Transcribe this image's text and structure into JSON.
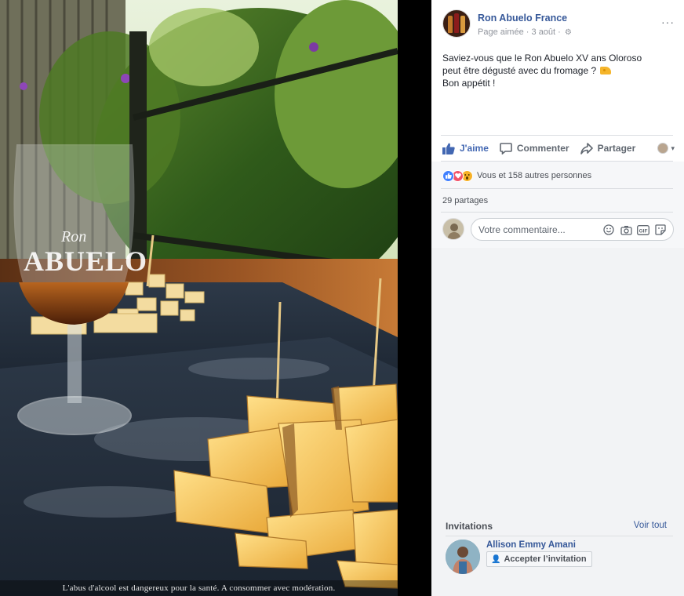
{
  "photo": {
    "glass_brand_line1": "Ron",
    "glass_brand_line2": "ABUELO",
    "caption": "L'abus d'alcool est dangereux pour la santé. A consommer avec modération."
  },
  "post": {
    "page_name": "Ron Abuelo France",
    "meta_liked": "Page aimée",
    "meta_separator": "·",
    "meta_date": "3 août",
    "more": "···",
    "text_line1": "Saviez-vous que le Ron Abuelo XV ans Oloroso",
    "text_line2": "peut être dégusté avec du fromage ?",
    "text_line3": "Bon appétit !"
  },
  "actions": {
    "like": "J'aime",
    "comment": "Commenter",
    "share": "Partager",
    "audience_caret": "▾"
  },
  "reactions": {
    "text": "Vous et 158 autres personnes",
    "shares": "29 partages"
  },
  "comment_box": {
    "placeholder": "Votre commentaire...",
    "gif": "GIF"
  },
  "invitations": {
    "title": "Invitations",
    "see_all": "Voir tout",
    "person_name": "Allison Emmy Amani",
    "accept": "Accepter l’invitation"
  },
  "colors": {
    "link_blue": "#365899",
    "like_blue": "#4267b2",
    "text_dark": "#1d2129",
    "text_grey": "#606770",
    "slate": "#2a3340",
    "cheese": "#f2c45a"
  }
}
